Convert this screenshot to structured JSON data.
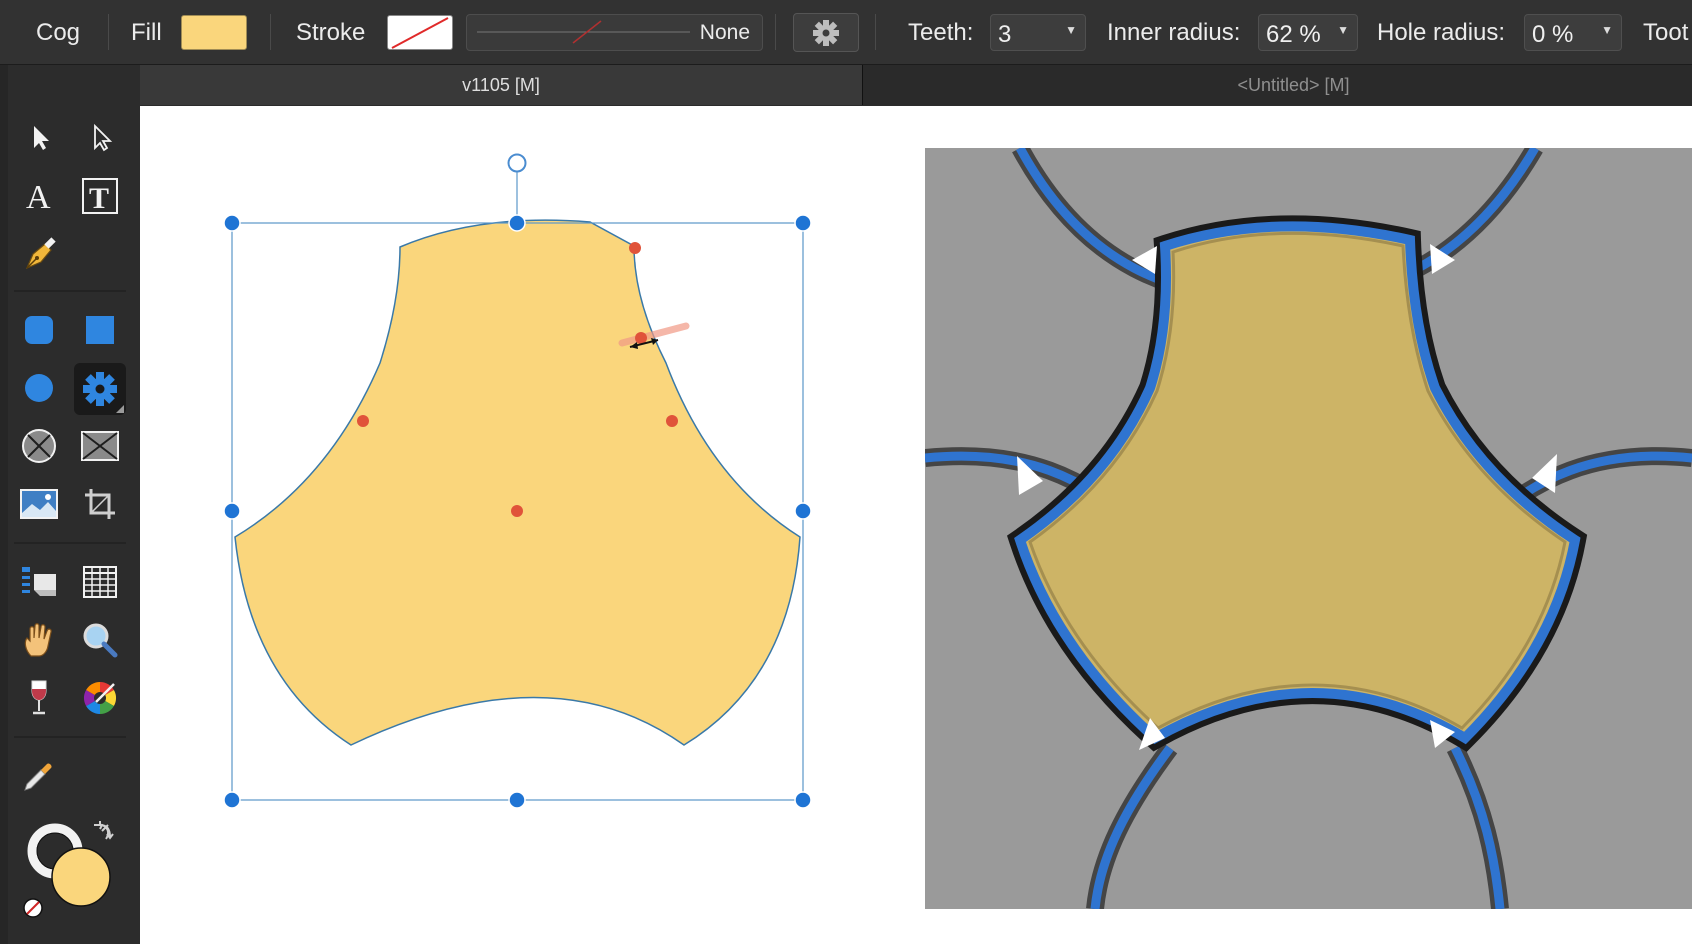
{
  "toolbar": {
    "tool_name": "Cog",
    "fill_label": "Fill",
    "fill_color": "#fad67c",
    "stroke_label": "Stroke",
    "stroke_color": "none",
    "stroke_style_value": "None",
    "settings_icon": "gear-icon",
    "teeth_label": "Teeth:",
    "teeth_value": "3",
    "inner_radius_label": "Inner radius:",
    "inner_radius_value": "62 %",
    "hole_radius_label": "Hole radius:",
    "hole_radius_value": "0 %",
    "tooth_label_cut": "Toot"
  },
  "tabs": [
    {
      "label": "v1105  [M]",
      "active": true
    },
    {
      "label": "<Untitled> [M]",
      "active": false
    }
  ],
  "tools": [
    {
      "name": "move-tool",
      "icon": "arrow-icon"
    },
    {
      "name": "node-tool",
      "icon": "hollow-arrow-icon"
    },
    {
      "name": "artistic-text-tool",
      "icon": "letter-a-icon"
    },
    {
      "name": "frame-text-tool",
      "icon": "framed-t-icon"
    },
    {
      "name": "pen-tool",
      "icon": "pen-nib-icon"
    },
    {
      "name": "rounded-rectangle-tool",
      "icon": "rounded-square-icon"
    },
    {
      "name": "rectangle-tool",
      "icon": "square-icon"
    },
    {
      "name": "ellipse-tool",
      "icon": "circle-icon"
    },
    {
      "name": "cog-tool",
      "icon": "cog-icon",
      "active": true
    },
    {
      "name": "ellipse-frame-tool",
      "icon": "circle-cross-icon"
    },
    {
      "name": "picture-frame-tool",
      "icon": "rect-cross-icon"
    },
    {
      "name": "place-image-tool",
      "icon": "picture-icon"
    },
    {
      "name": "crop-tool",
      "icon": "crop-icon"
    },
    {
      "name": "text-flow-tool",
      "icon": "text-list-icon"
    },
    {
      "name": "table-tool",
      "icon": "table-grid-icon"
    },
    {
      "name": "hand-tool",
      "icon": "hand-icon"
    },
    {
      "name": "zoom-tool",
      "icon": "magnifier-icon"
    },
    {
      "name": "transparency-tool",
      "icon": "wine-glass-icon"
    },
    {
      "name": "color-picker-tool",
      "icon": "color-wheel-icon"
    },
    {
      "name": "eyedropper-tool",
      "icon": "dropper-icon"
    }
  ],
  "colors": {
    "accent_blue": "#1f74d4",
    "node_red": "#e0533a",
    "preview_gray": "#9a9a9a",
    "preview_fill": "#cdb466",
    "selection_blue": "#5b97c9"
  }
}
